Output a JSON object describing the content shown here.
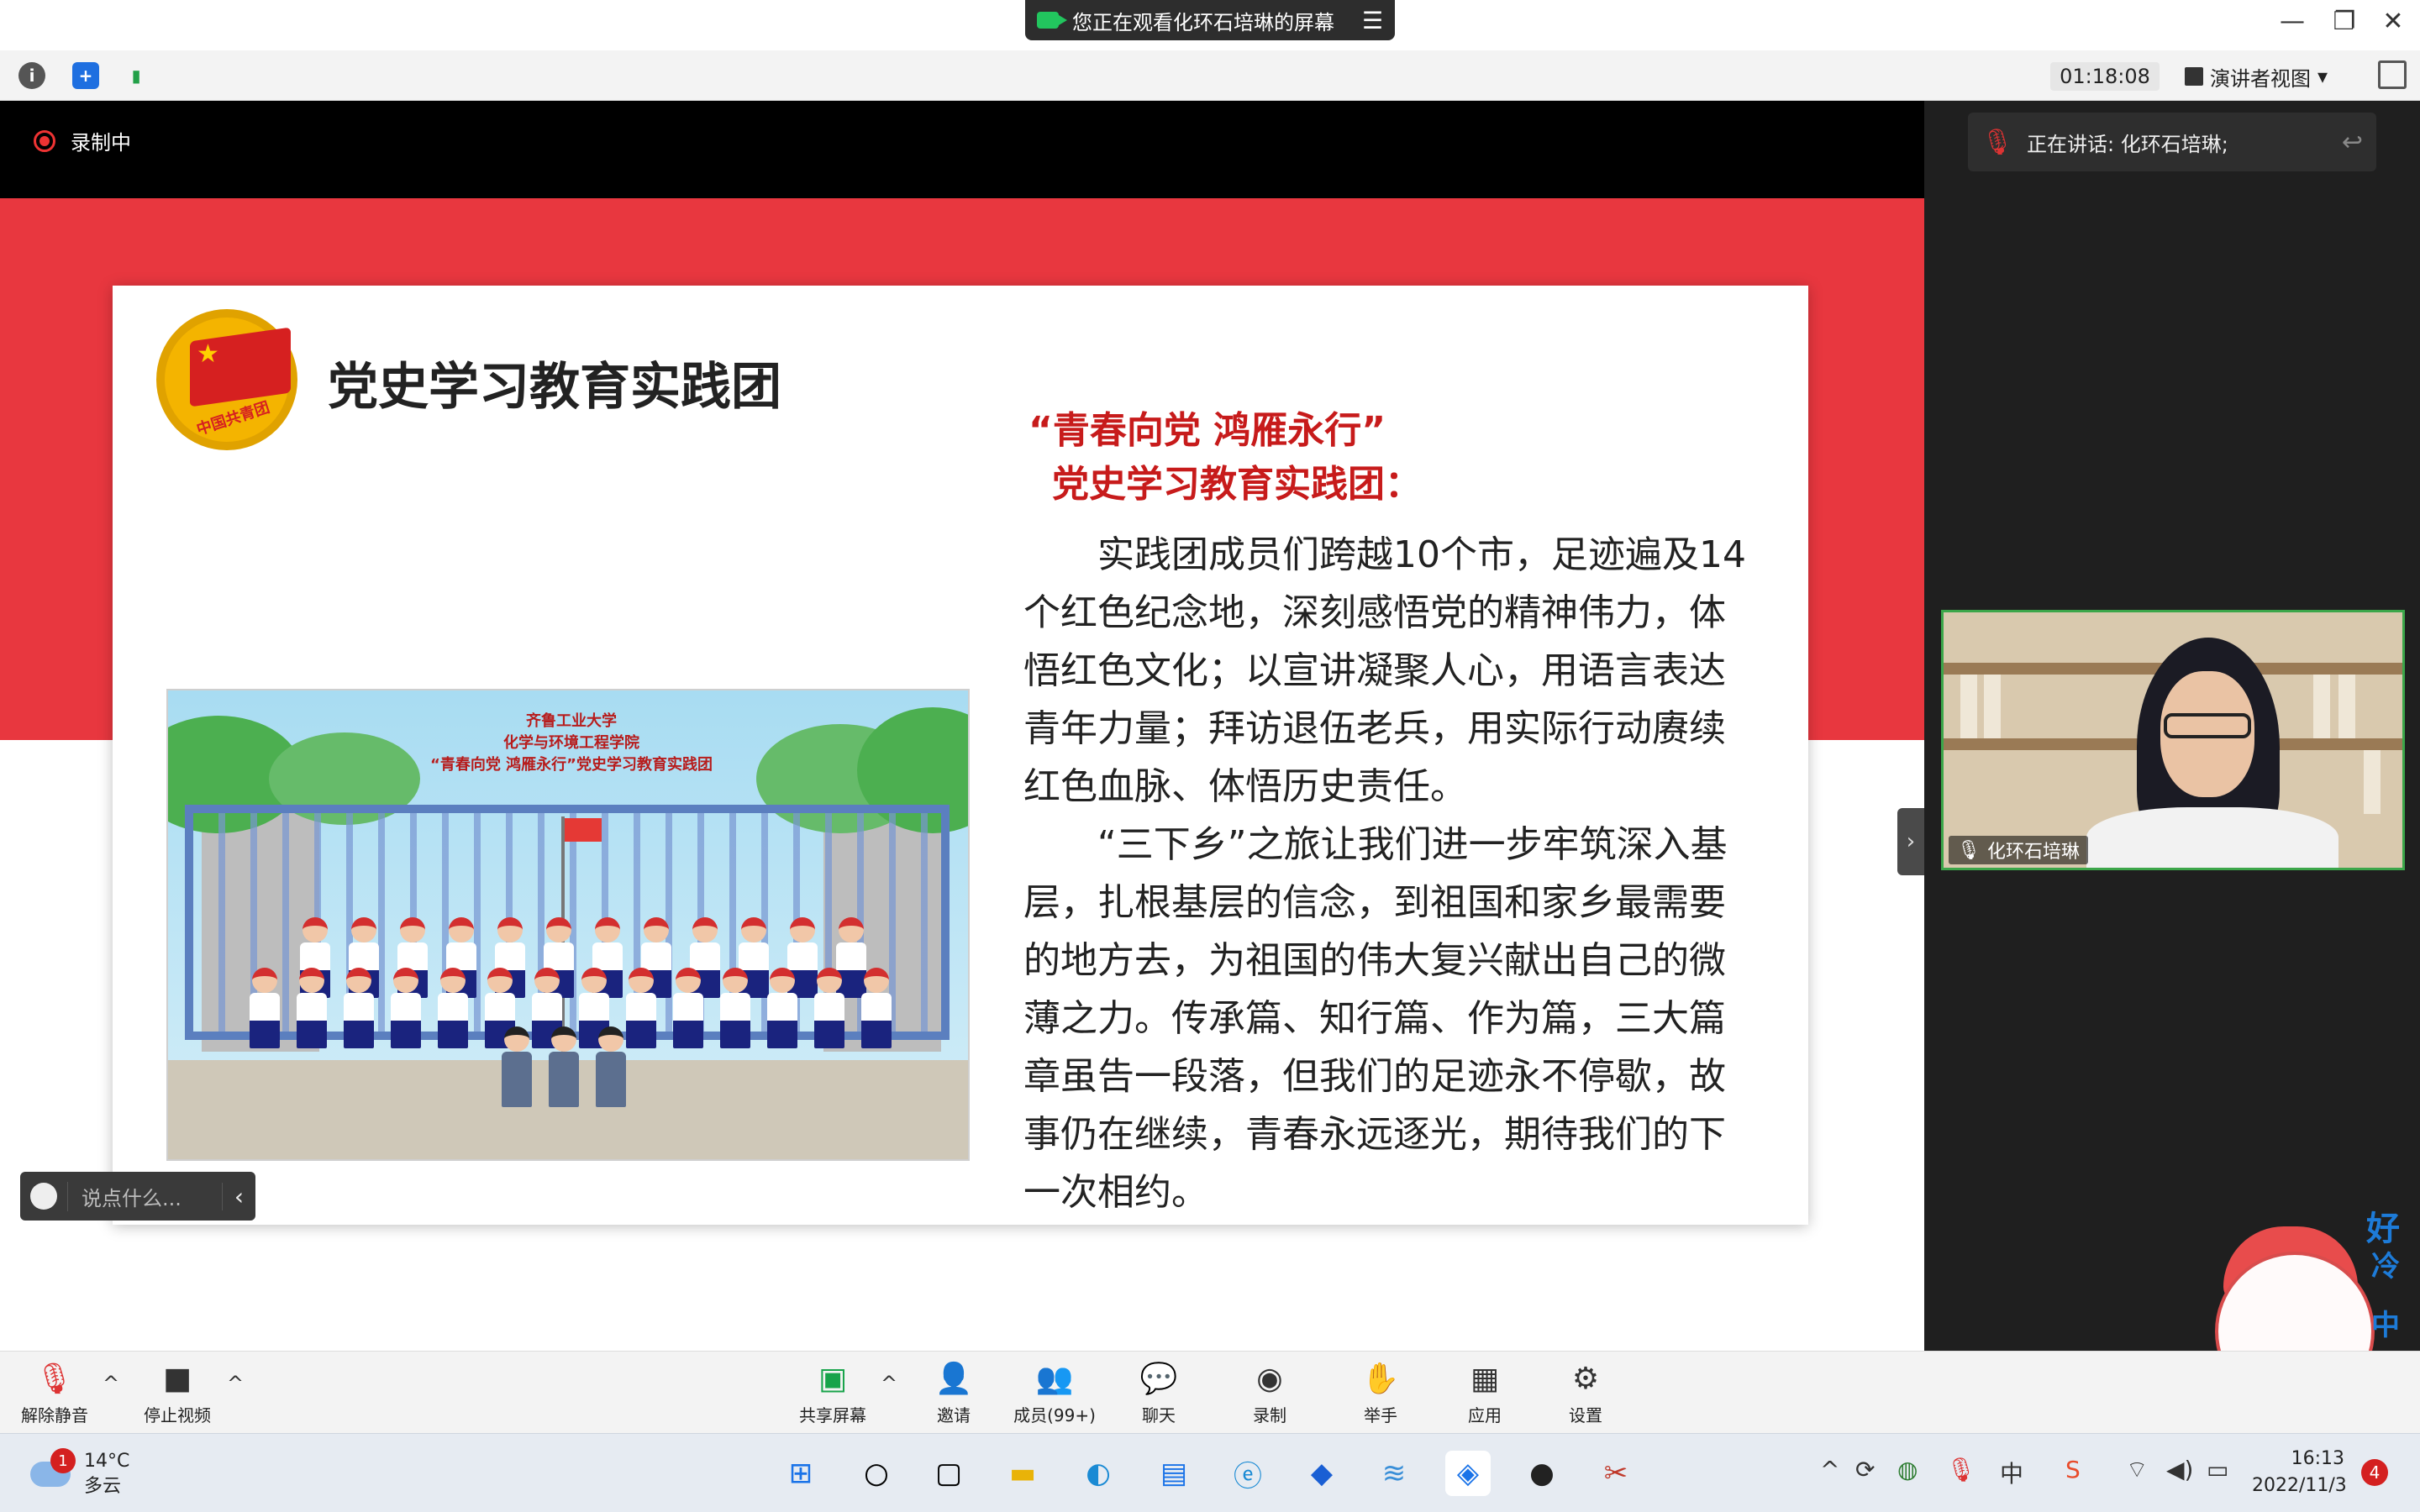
{
  "window": {
    "share_banner": "您正在观看化环石培琳的屏幕",
    "minimize": "—",
    "restore": "❐",
    "close": "✕"
  },
  "meeting_bar": {
    "timer": "01:18:08",
    "view_mode": "演讲者视图",
    "icons": [
      "info-icon",
      "shield-icon",
      "signal-icon",
      "fullscreen-icon"
    ]
  },
  "stage": {
    "recording_label": "录制中",
    "chat_placeholder": "说点什么..."
  },
  "slide": {
    "emblem_text": "中国共青团",
    "title": "党史学习教育实践团",
    "slogan_line1": "“青春向党  鸿雁永行”",
    "slogan_line2": "党史学习教育实践团：",
    "paragraph1": "实践团成员们跨越10个市，足迹遍及14个红色纪念地，深刻感悟党的精神伟力，体悟红色文化；以宣讲凝聚人心，用语言表达青年力量；拜访退伍老兵，用实际行动赓续红色血脉、体悟历史责任。",
    "paragraph2": "“三下乡”之旅让我们进一步牢筑深入基层，扎根基层的信念，到祖国和家乡最需要的地方去，为祖国的伟大复兴献出自己的微薄之力。传承篇、知行篇、作为篇，三大篇章虽告一段落，但我们的足迹永不停歇，故事仍在继续，青春永远逐光，期待我们的下一次相约。",
    "photo_caption_line1": "齐鲁工业大学",
    "photo_caption_line2": "化学与环境工程学院",
    "photo_caption_line3": "“青春向党 鸿雁永行”党史学习教育实践团"
  },
  "right_panel": {
    "speaking_label": "正在讲话: 化环石培琳;",
    "participant_name": "化环石培琳"
  },
  "sticker": {
    "text1": "好",
    "text2": "冷",
    "text3": "中"
  },
  "controls": {
    "unmute": "解除静音",
    "stop_video": "停止视频",
    "share_screen": "共享屏幕",
    "invite": "邀请",
    "members": "成员(99+)",
    "chat": "聊天",
    "record": "录制",
    "raise_hand": "举手",
    "apps": "应用",
    "settings": "设置"
  },
  "taskbar": {
    "weather_badge": "1",
    "temperature": "14°C",
    "weather_desc": "多云",
    "time": "16:13",
    "date": "2022/11/3",
    "notification_count": "4",
    "ime": "中"
  }
}
